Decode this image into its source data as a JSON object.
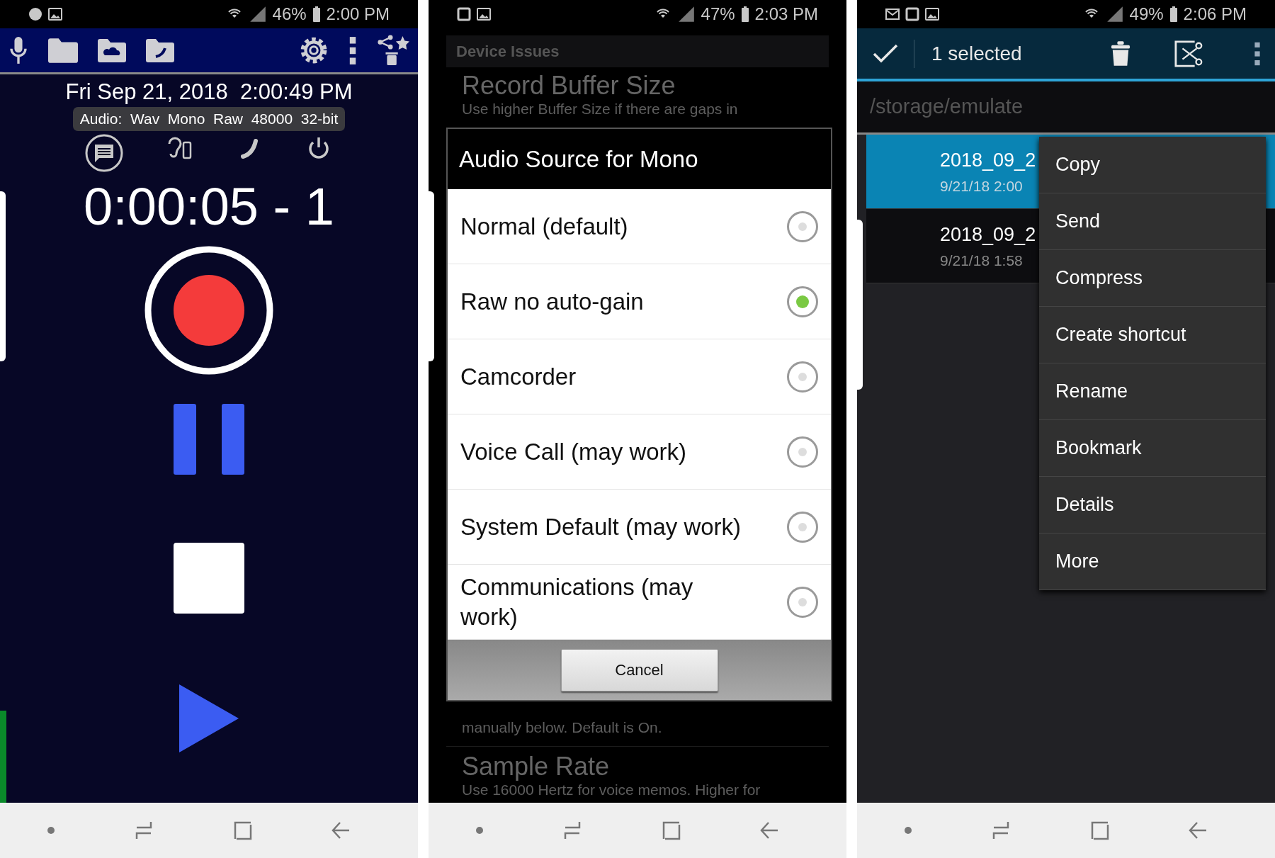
{
  "recorder": {
    "status_bar": {
      "battery": "46%",
      "time": "2:00 PM"
    },
    "datetime": "Fri Sep 21, 2018  2:00:49 PM",
    "audio_info": "Audio:  Wav  Mono  Raw  48000  32-bit",
    "timer": "0:00:05 - 1"
  },
  "settings": {
    "status_bar": {
      "battery": "47%",
      "time": "2:03 PM"
    },
    "section_header": "Device Issues",
    "items_above": [
      {
        "title": "Record Buffer Size",
        "summary": "Use higher Buffer Size if there are gaps in"
      }
    ],
    "items_below": [
      {
        "summary": "manually below. Default is On."
      },
      {
        "title": "Sample Rate",
        "summary": "Use 16000 Hertz for voice memos. Higher for"
      }
    ],
    "dialog": {
      "title": "Audio Source for Mono",
      "options": [
        {
          "label": "Normal (default)",
          "selected": false
        },
        {
          "label": "Raw no auto-gain",
          "selected": true
        },
        {
          "label": "Camcorder",
          "selected": false
        },
        {
          "label": "Voice Call (may work)",
          "selected": false
        },
        {
          "label": "System Default (may work)",
          "selected": false
        },
        {
          "label": "Communications (may work)",
          "selected": false
        }
      ],
      "cancel_button": "Cancel"
    }
  },
  "file_manager": {
    "status_bar": {
      "battery": "49%",
      "time": "2:06 PM"
    },
    "selection_count": "1 selected",
    "path": "/storage/emulate",
    "files": [
      {
        "name": "2018_09_2",
        "date": "9/21/18 2:00",
        "selected": true
      },
      {
        "name": "2018_09_2",
        "date": "9/21/18 1:58",
        "selected": false
      }
    ],
    "menu": [
      "Copy",
      "Send",
      "Compress",
      "Create shortcut",
      "Rename",
      "Bookmark",
      "Details",
      "More"
    ]
  }
}
